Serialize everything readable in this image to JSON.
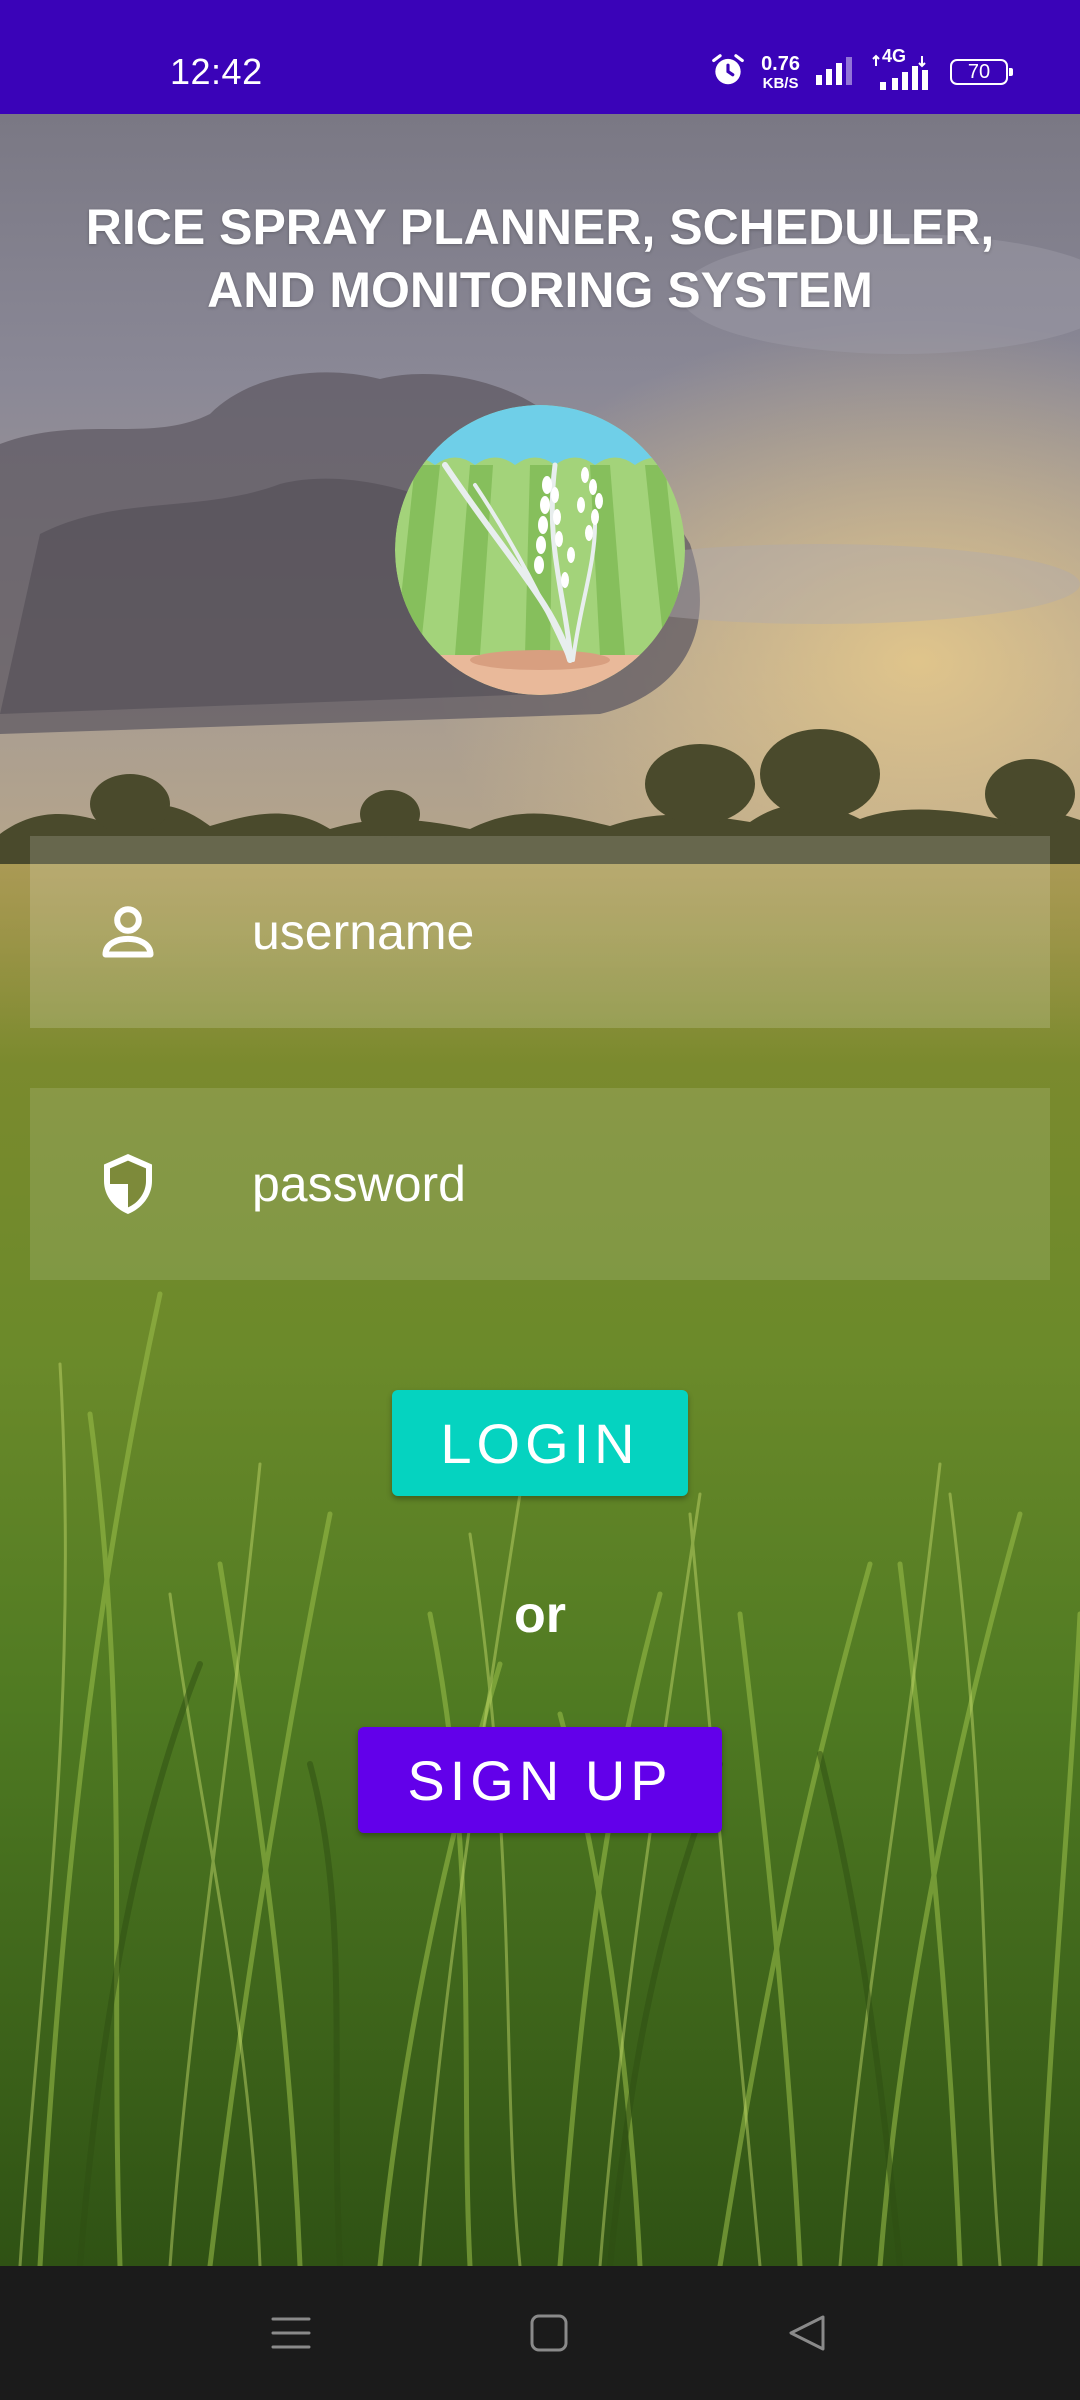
{
  "status_bar": {
    "time": "12:42",
    "net_speed_value": "0.76",
    "net_speed_unit": "KB/S",
    "network_type": "4G",
    "battery": "70"
  },
  "header": {
    "title": "RICE SPRAY PLANNER, SCHEDULER, AND MONITORING SYSTEM"
  },
  "form": {
    "username_placeholder": "username",
    "password_placeholder": "password",
    "username_icon": "person-icon",
    "password_icon": "shield-icon"
  },
  "actions": {
    "login_label": "LOGIN",
    "or_label": "or",
    "signup_label": "SIGN UP"
  },
  "colors": {
    "status_bar": "#3a03b8",
    "login_button": "#05d3c0",
    "signup_button": "#6200ea",
    "nav_bar": "#1b1b1b"
  }
}
